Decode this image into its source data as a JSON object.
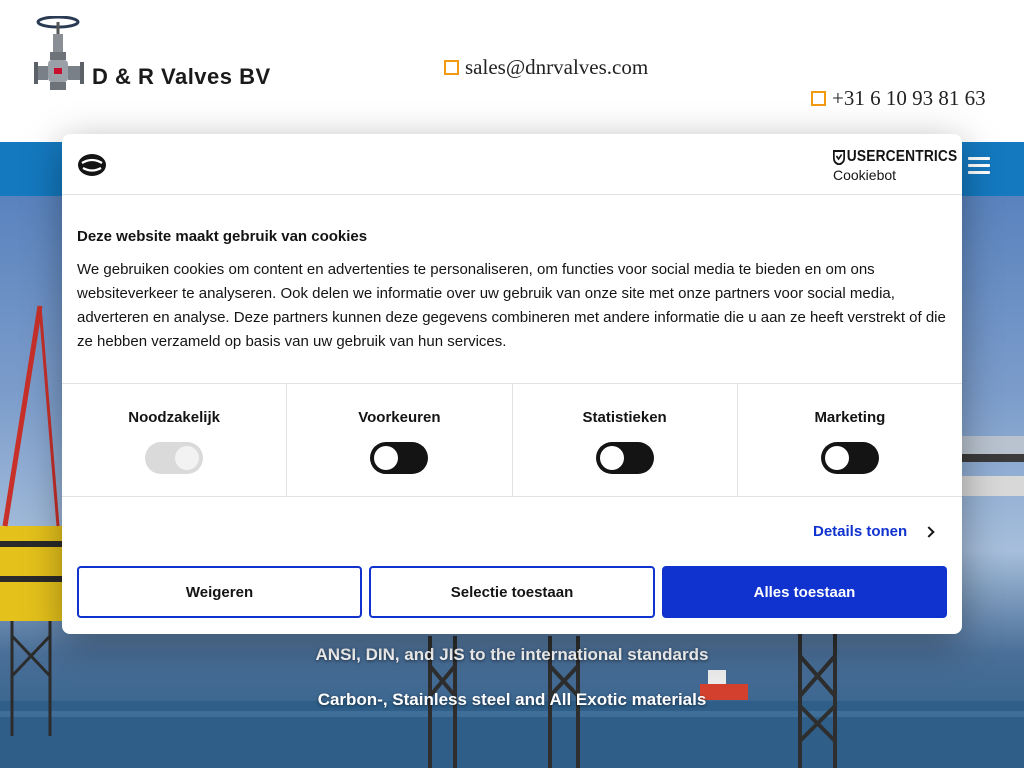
{
  "header": {
    "brand": "D & R Valves BV",
    "email": "sales@dnrvalves.com",
    "phone": "+31 6 10 93 81 63"
  },
  "hero": {
    "line1": "ANSI, DIN, and JIS to the international standards",
    "line2": "Carbon-, Stainless steel and All Exotic materials"
  },
  "cookie_dialog": {
    "provider_name": "USERCENTRICS",
    "provider_sub": "Cookiebot",
    "title": "Deze website maakt gebruik van cookies",
    "body": "We gebruiken cookies om content en advertenties te personaliseren, om functies voor social media te bieden en om ons websiteverkeer te analyseren. Ook delen we informatie over uw gebruik van onze site met onze partners voor social media, adverteren en analyse. Deze partners kunnen deze gegevens combineren met andere informatie die u aan ze heeft verstrekt of die ze hebben verzameld op basis van uw gebruik van hun services.",
    "categories": [
      {
        "label": "Noodzakelijk",
        "enabled": true,
        "locked": true
      },
      {
        "label": "Voorkeuren",
        "enabled": false,
        "locked": false
      },
      {
        "label": "Statistieken",
        "enabled": false,
        "locked": false
      },
      {
        "label": "Marketing",
        "enabled": false,
        "locked": false
      }
    ],
    "details_label": "Details tonen",
    "buttons": {
      "reject": "Weigeren",
      "allow_selection": "Selectie toestaan",
      "allow_all": "Alles toestaan"
    }
  },
  "colors": {
    "accent_blue": "#1032cf",
    "nav_blue": "#1479bf",
    "icon_orange": "#f29a12"
  },
  "icons": {
    "logo": "valve-logo-icon",
    "email": "square-icon",
    "phone": "square-icon",
    "menu": "hamburger-icon",
    "cookie": "cookie-icon",
    "provider": "shield-icon",
    "details": "chevron-right-icon"
  }
}
